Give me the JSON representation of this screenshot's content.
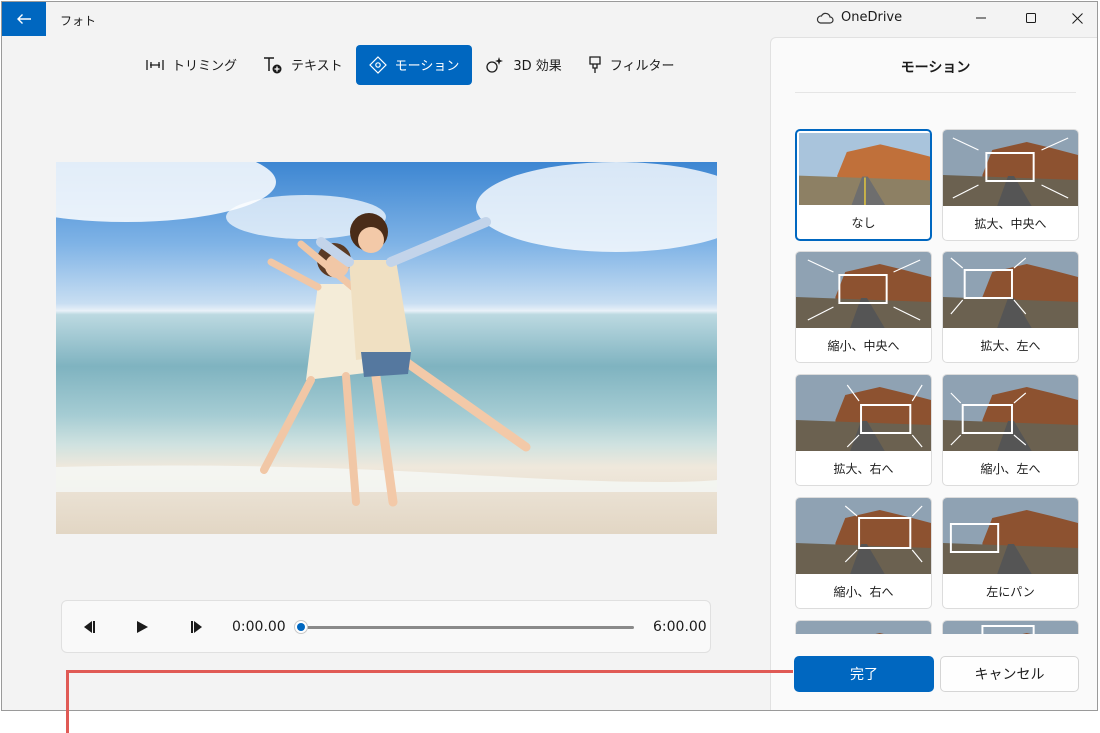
{
  "app": {
    "title": "フォト",
    "account": "OneDrive"
  },
  "toolbar": {
    "items": [
      {
        "label": "トリミング",
        "icon": "trim-icon",
        "active": false
      },
      {
        "label": "テキスト",
        "icon": "text-add-icon",
        "active": false
      },
      {
        "label": "モーション",
        "icon": "motion-icon",
        "active": true
      },
      {
        "label": "3D 効果",
        "icon": "3d-effects-icon",
        "active": false
      },
      {
        "label": "フィルター",
        "icon": "filter-icon",
        "active": false
      }
    ]
  },
  "player": {
    "current_time": "0:00.00",
    "duration": "6:00.00",
    "progress": 0
  },
  "panel": {
    "title": "モーション",
    "options": [
      "なし",
      "拡大、中央へ",
      "縮小、中央へ",
      "拡大、左へ",
      "拡大、右へ",
      "縮小、左へ",
      "縮小、右へ",
      "左にパン"
    ],
    "selected": "なし",
    "done_label": "完了",
    "cancel_label": "キャンセル"
  },
  "colors": {
    "accent": "#0067c0",
    "callout": "#e05a55"
  }
}
